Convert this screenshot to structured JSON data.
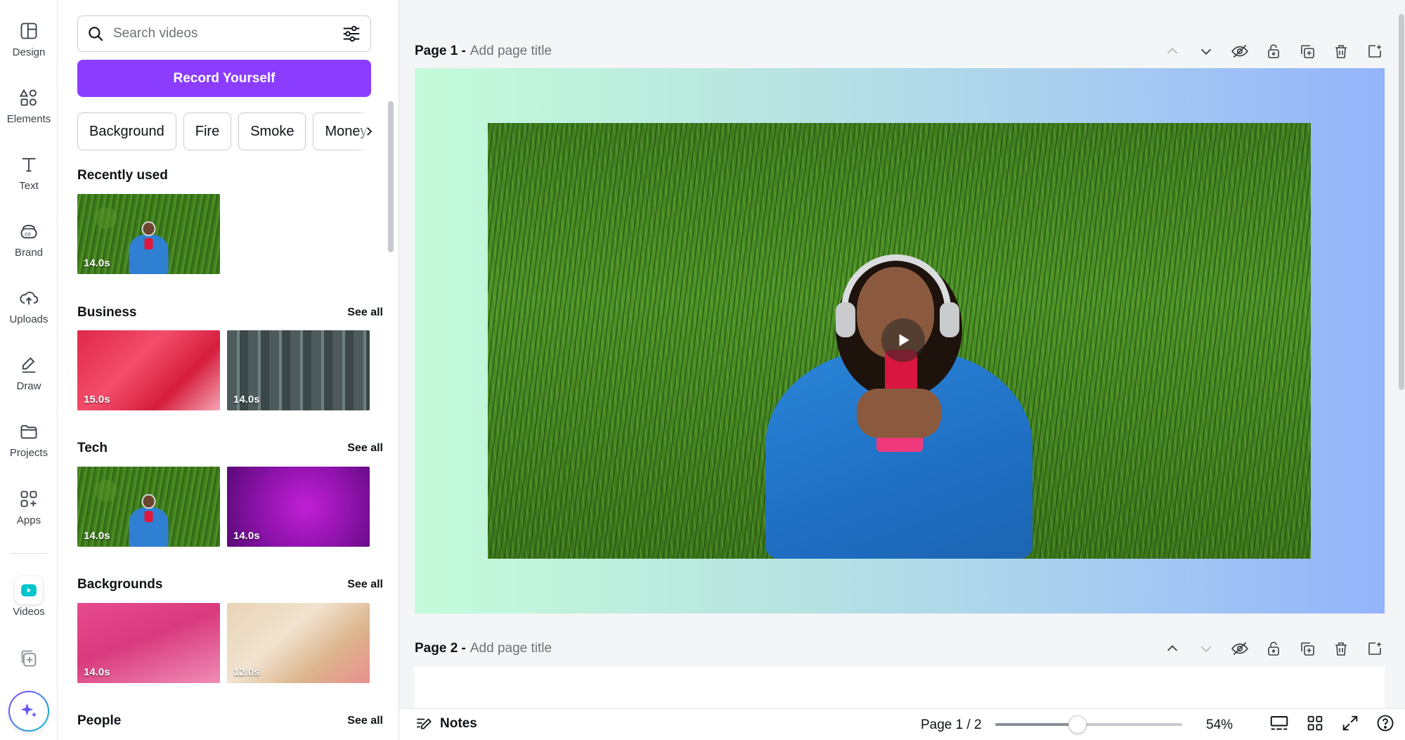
{
  "rail": {
    "items": [
      {
        "label": "Design",
        "icon": "layout-icon"
      },
      {
        "label": "Elements",
        "icon": "shapes-icon"
      },
      {
        "label": "Text",
        "icon": "text-icon"
      },
      {
        "label": "Brand",
        "icon": "brand-icon"
      },
      {
        "label": "Uploads",
        "icon": "cloud-upload-icon"
      },
      {
        "label": "Draw",
        "icon": "pen-icon"
      },
      {
        "label": "Projects",
        "icon": "folder-icon"
      },
      {
        "label": "Apps",
        "icon": "apps-grid-icon"
      },
      {
        "label": "Videos",
        "icon": "play-video-icon"
      }
    ],
    "active": "Videos",
    "accent": "#00c4cc"
  },
  "panel": {
    "search_placeholder": "Search videos",
    "record_label": "Record Yourself",
    "chips": [
      "Background",
      "Fire",
      "Smoke",
      "Money"
    ],
    "see_all": "See all",
    "recently_used": {
      "title": "Recently used",
      "items": [
        {
          "duration": "14.0s"
        }
      ]
    },
    "sections": [
      {
        "title": "Business",
        "items": [
          {
            "duration": "15.0s"
          },
          {
            "duration": "14.0s"
          }
        ]
      },
      {
        "title": "Tech",
        "items": [
          {
            "duration": "14.0s"
          },
          {
            "duration": "14.0s"
          }
        ]
      },
      {
        "title": "Backgrounds",
        "items": [
          {
            "duration": "14.0s"
          },
          {
            "duration": "12.0s"
          }
        ]
      },
      {
        "title": "People",
        "items": []
      }
    ]
  },
  "pages": [
    {
      "label": "Page 1 -",
      "title_placeholder": "Add page title"
    },
    {
      "label": "Page 2 -",
      "title_placeholder": "Add page title"
    }
  ],
  "bottom": {
    "notes_label": "Notes",
    "pager": "Page 1 / 2",
    "zoom": "54%",
    "zoom_fraction": 0.44
  },
  "colors": {
    "brand_purple": "#8b3dff",
    "gradient_start": "#c4fbda",
    "gradient_end": "#93b4fb"
  }
}
